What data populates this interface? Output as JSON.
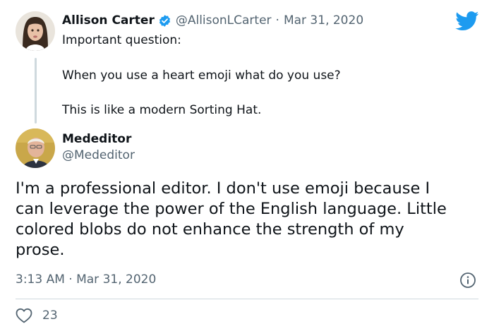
{
  "reply_to": {
    "name": "Allison Carter",
    "handle": "@AllisonLCarter",
    "separator": "·",
    "date": "Mar 31, 2020",
    "lines": [
      "Important question:",
      "When you use a heart emoji what do you use?",
      "This is like a modern Sorting Hat."
    ]
  },
  "tweet": {
    "name": "Mededitor",
    "handle": "@Mededitor",
    "text_lines": [
      "I'm a professional editor. I don't use emoji because I",
      "can leverage the power of the English language. Little",
      "colored blobs do not enhance the strength of my",
      "prose."
    ],
    "timestamp": "3:13 AM · Mar 31, 2020",
    "like_count": "23"
  },
  "icons": {
    "verified": "verified-badge-icon",
    "brand": "twitter-bird-icon",
    "info": "info-icon",
    "like": "heart-outline-icon"
  },
  "colors": {
    "twitter_blue": "#1d9bf0",
    "text": "#0f1419",
    "muted": "#536471"
  }
}
